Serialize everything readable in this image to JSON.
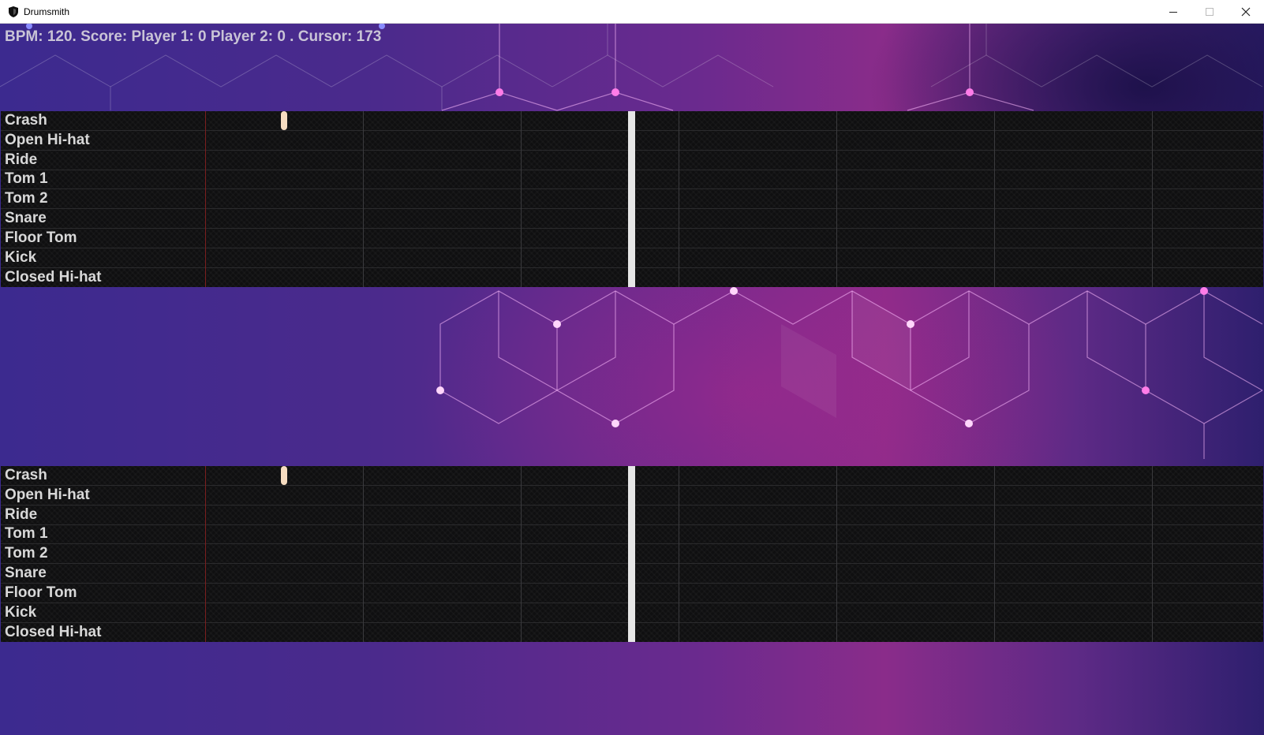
{
  "window": {
    "title": "Drumsmith",
    "icon": "shield-icon",
    "controls": [
      "minimize-icon",
      "maximize-icon",
      "close-icon"
    ]
  },
  "status": {
    "text": "BPM: 120. Score: Player 1: 0 Player 2: 0 . Cursor: 173"
  },
  "colors": {
    "note": "#f6dcc0",
    "playhead": "#e6e6e6",
    "track_bg": "#0f0f10",
    "marker_line": "#7a1e1e",
    "accent_pink": "#e05ad8"
  },
  "players": [
    {
      "lanes": [
        {
          "label": "Crash"
        },
        {
          "label": "Open Hi-hat"
        },
        {
          "label": "Ride"
        },
        {
          "label": "Tom 1"
        },
        {
          "label": "Tom 2"
        },
        {
          "label": "Snare"
        },
        {
          "label": "Floor Tom"
        },
        {
          "label": "Kick"
        },
        {
          "label": "Closed Hi-hat"
        }
      ]
    },
    {
      "lanes": [
        {
          "label": "Crash"
        },
        {
          "label": "Open Hi-hat"
        },
        {
          "label": "Ride"
        },
        {
          "label": "Tom 1"
        },
        {
          "label": "Tom 2"
        },
        {
          "label": "Snare"
        },
        {
          "label": "Floor Tom"
        },
        {
          "label": "Kick"
        },
        {
          "label": "Closed Hi-hat"
        }
      ]
    }
  ]
}
